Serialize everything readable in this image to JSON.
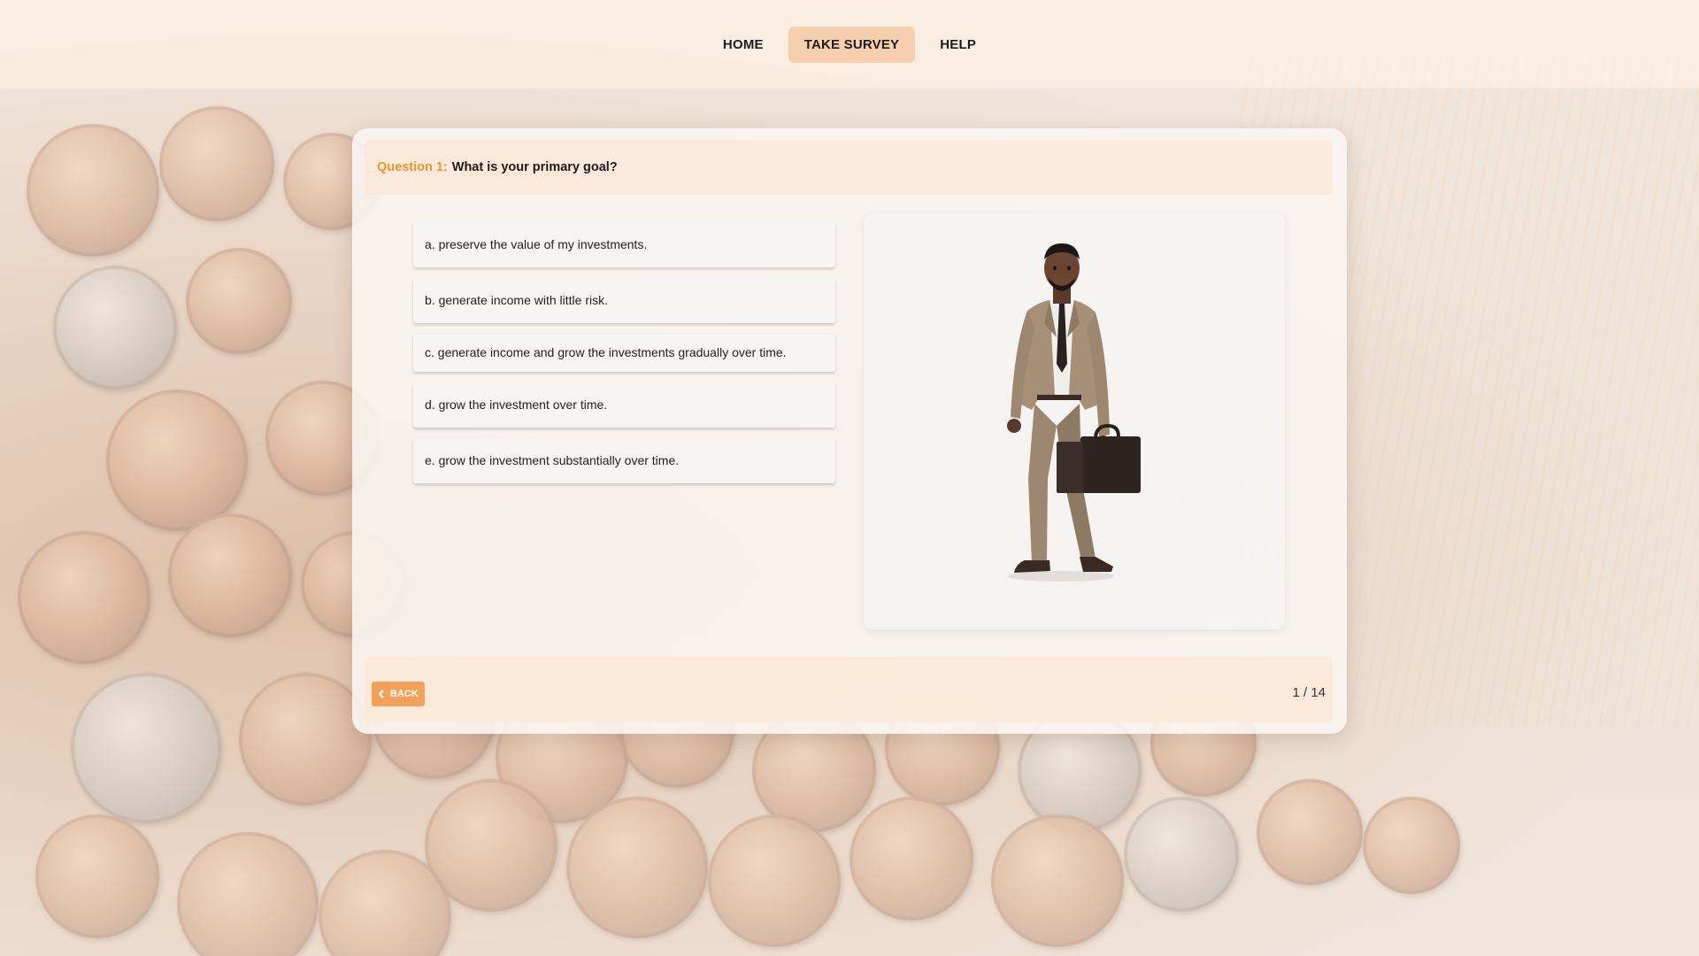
{
  "nav": {
    "items": [
      {
        "label": "HOME",
        "active": false
      },
      {
        "label": "TAKE SURVEY",
        "active": true
      },
      {
        "label": "HELP",
        "active": false
      }
    ]
  },
  "question": {
    "number_label": "Question 1:",
    "text": "What is your primary goal?"
  },
  "answers": [
    "a. preserve the value of my investments.",
    "b. generate income with little risk.",
    "c. generate income and grow the investments gradually over time.",
    "d. grow the investment over time.",
    "e. grow the investment substantially over time."
  ],
  "footer": {
    "back_label": "BACK",
    "progress": "1 / 14"
  },
  "colors": {
    "accent": "#e8962a",
    "button": "#f3a05a",
    "active_nav": "#f5cfae"
  }
}
